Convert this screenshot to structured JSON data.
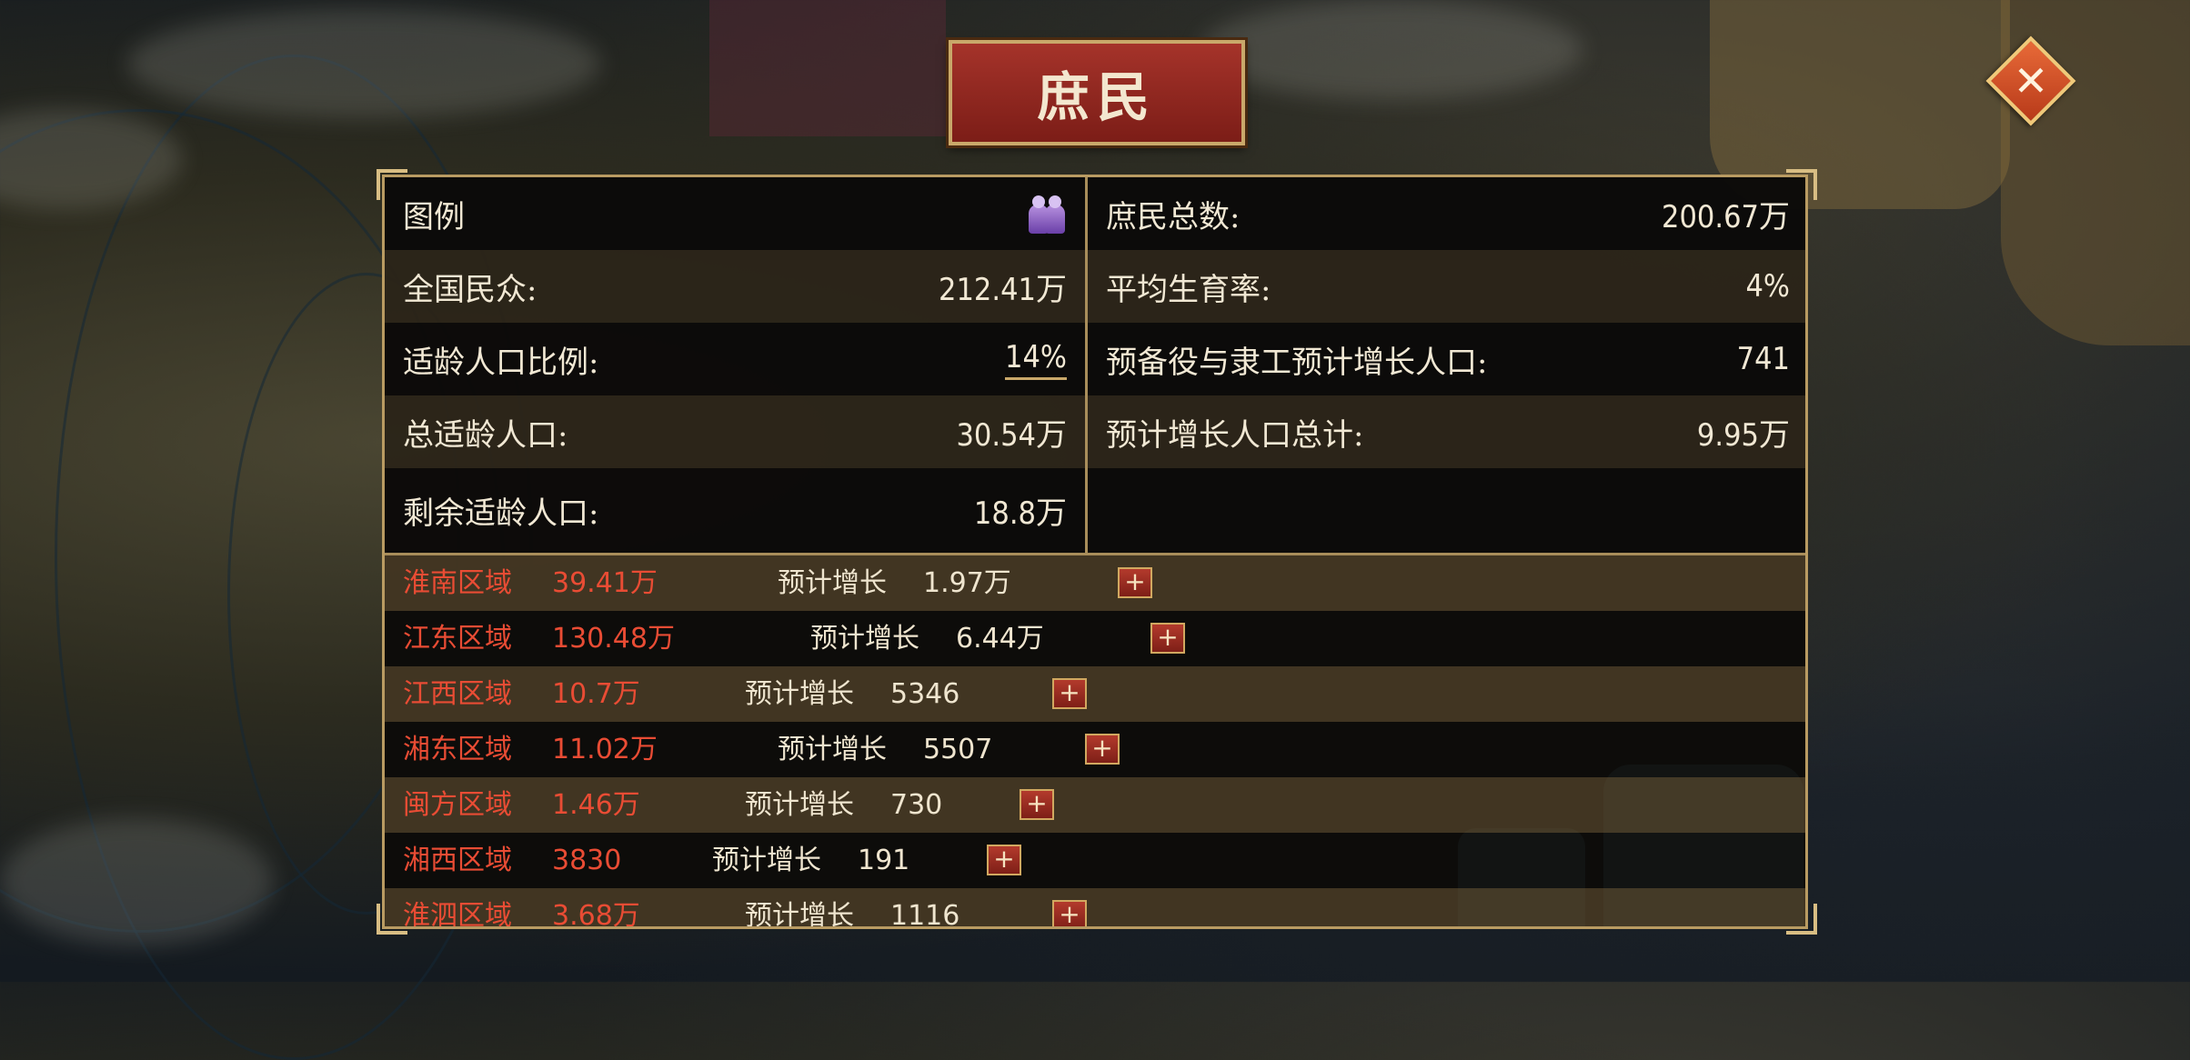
{
  "title": "庶民",
  "close_icon": "close-x-icon",
  "stats_left": [
    {
      "label": "图例",
      "value": ""
    },
    {
      "label": "全国民众:",
      "value": "212.41万"
    },
    {
      "label": "适龄人口比例:",
      "value": "14%"
    },
    {
      "label": "总适龄人口:",
      "value": "30.54万"
    },
    {
      "label": "剩余适龄人口:",
      "value": "18.8万"
    }
  ],
  "stats_right": [
    {
      "label": "庶民总数:",
      "value": "200.67万"
    },
    {
      "label": "平均生育率:",
      "value": "4%"
    },
    {
      "label": "预备役与隶工预计增长人口:",
      "value": "741"
    },
    {
      "label": "预计增长人口总计:",
      "value": "9.95万"
    }
  ],
  "legend_icon": "population-figures-icon",
  "growth_label": "预计增长",
  "plus_symbol": "+",
  "regions": [
    {
      "name": "淮南区域",
      "population": "39.41万",
      "growth": "1.97万"
    },
    {
      "name": "江东区域",
      "population": "130.48万",
      "growth": "6.44万"
    },
    {
      "name": "江西区域",
      "population": "10.7万",
      "growth": "5346"
    },
    {
      "name": "湘东区域",
      "population": "11.02万",
      "growth": "5507"
    },
    {
      "name": "闽方区域",
      "population": "1.46万",
      "growth": "730"
    },
    {
      "name": "湘西区域",
      "population": "3830",
      "growth": "191"
    },
    {
      "name": "淮泗区域",
      "population": "3.68万",
      "growth": "1116"
    }
  ],
  "colors": {
    "region_text": "#e94c34",
    "panel_border": "#b99b62",
    "title_plate": "#8e241d"
  }
}
